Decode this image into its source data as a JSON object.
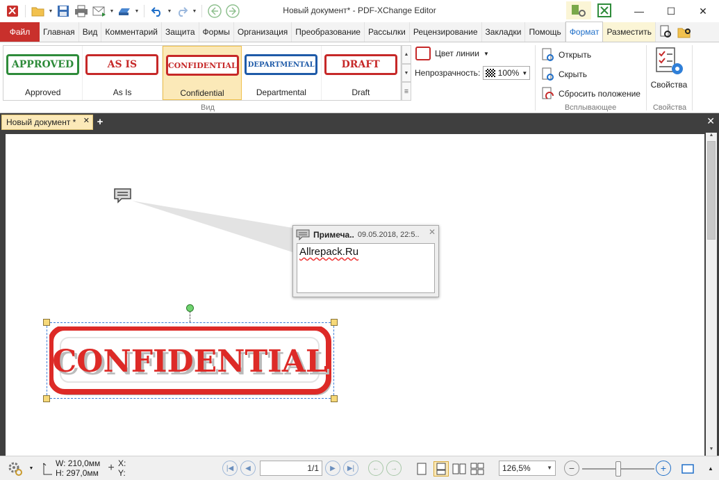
{
  "window": {
    "title": "Новый документ* - PDF-XChange Editor"
  },
  "ribbon_tabs": {
    "file": "Файл",
    "items": [
      "Главная",
      "Вид",
      "Комментарий",
      "Защита",
      "Формы",
      "Организация",
      "Преобразование",
      "Рассылки",
      "Рецензирование",
      "Закладки",
      "Помощь",
      "Формат",
      "Разместить"
    ],
    "active": "Формат"
  },
  "gallery": {
    "items": [
      {
        "stamp": "APPROVED",
        "label": "Approved",
        "color": "#2e8b3a"
      },
      {
        "stamp": "AS IS",
        "label": "As Is",
        "color": "#c62828"
      },
      {
        "stamp": "CONFIDENTIAL",
        "label": "Confidential",
        "color": "#c62828"
      },
      {
        "stamp": "DEPARTMENTAL",
        "label": "Departmental",
        "color": "#1e5aa8"
      },
      {
        "stamp": "DRAFT",
        "label": "Draft",
        "color": "#c62828"
      }
    ],
    "selected": "Confidential",
    "group_label": "Вид"
  },
  "format": {
    "line_color_label": "Цвет линии",
    "line_color": "#c62828",
    "opacity_label": "Непрозрачность:",
    "opacity_value": "100%"
  },
  "popup_group": {
    "open": "Открыть",
    "hide": "Скрыть",
    "reset": "Сбросить положение",
    "group_label": "Всплывающее"
  },
  "properties_group": {
    "button": "Свойства",
    "group_label": "Свойства"
  },
  "document": {
    "tab_title": "Новый документ *",
    "note_title": "Примеча..",
    "note_date": "09.05.2018, 22:5..",
    "note_text": "Allrepack.Ru",
    "stamp_text": "CONFIDENTIAL"
  },
  "status": {
    "width": "W: 210,0мм",
    "height": "H: 297,0мм",
    "x": "X:",
    "y": "Y:",
    "page": "1/1",
    "zoom": "126,5%"
  },
  "colors": {
    "file_tab": "#c9302c",
    "accent": "#1e6ec8",
    "stamp_red": "#dd2a27",
    "selection": "#fbe9b8"
  }
}
